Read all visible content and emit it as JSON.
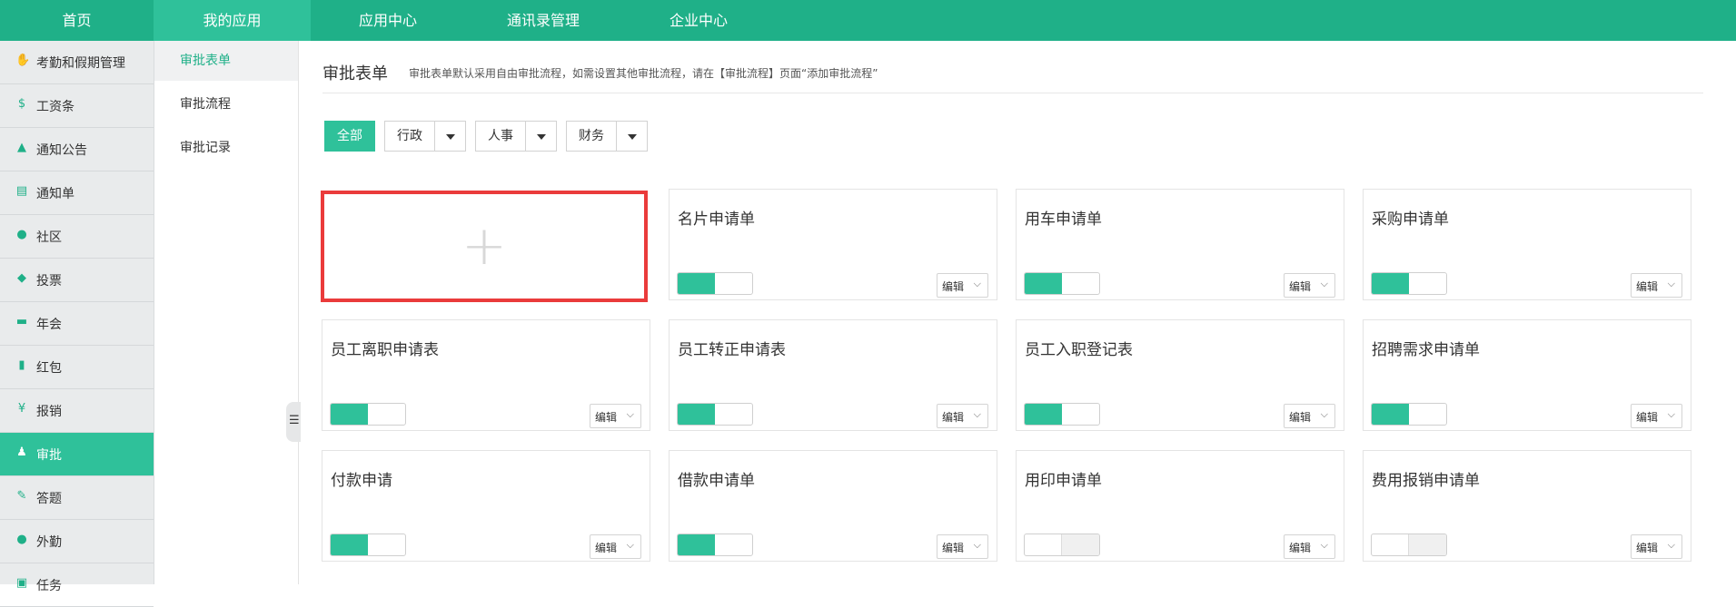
{
  "topnav": {
    "tabs": [
      {
        "label": "首页"
      },
      {
        "label": "我的应用"
      },
      {
        "label": "应用中心"
      },
      {
        "label": "通讯录管理"
      },
      {
        "label": "企业中心"
      }
    ],
    "active_index": 1
  },
  "sidebar": {
    "items": [
      {
        "label": "考勤和假期管理",
        "icon": "hand-icon"
      },
      {
        "label": "工资条",
        "icon": "salary-icon"
      },
      {
        "label": "通知公告",
        "icon": "bell-icon"
      },
      {
        "label": "通知单",
        "icon": "notice-icon"
      },
      {
        "label": "社区",
        "icon": "chat-icon"
      },
      {
        "label": "投票",
        "icon": "vote-icon"
      },
      {
        "label": "年会",
        "icon": "card-icon"
      },
      {
        "label": "红包",
        "icon": "redpacket-icon"
      },
      {
        "label": "报销",
        "icon": "yen-icon"
      },
      {
        "label": "审批",
        "icon": "stamp-icon"
      },
      {
        "label": "答题",
        "icon": "quiz-icon"
      },
      {
        "label": "外勤",
        "icon": "location-icon"
      },
      {
        "label": "任务",
        "icon": "task-icon"
      }
    ],
    "active_index": 9
  },
  "submenu": {
    "items": [
      {
        "label": "审批表单"
      },
      {
        "label": "审批流程"
      },
      {
        "label": "审批记录"
      }
    ],
    "active_index": 0
  },
  "main": {
    "title": "审批表单",
    "description": "审批表单默认采用自由审批流程，如需设置其他审批流程，请在【审批流程】页面“添加审批流程”",
    "filters": [
      {
        "label": "全部",
        "active": true,
        "dropdown": false
      },
      {
        "label": "行政",
        "active": false,
        "dropdown": true
      },
      {
        "label": "人事",
        "active": false,
        "dropdown": true
      },
      {
        "label": "财务",
        "active": false,
        "dropdown": true
      }
    ],
    "add_icon": "+",
    "edit_label": "编辑",
    "edit_chevron": "⌵",
    "forms": [
      {
        "name": "名片申请单",
        "enabled": true
      },
      {
        "name": "用车申请单",
        "enabled": true
      },
      {
        "name": "采购申请单",
        "enabled": true
      },
      {
        "name": "员工离职申请表",
        "enabled": true
      },
      {
        "name": "员工转正申请表",
        "enabled": true
      },
      {
        "name": "员工入职登记表",
        "enabled": true
      },
      {
        "name": "招聘需求申请单",
        "enabled": true
      },
      {
        "name": "付款申请",
        "enabled": true
      },
      {
        "name": "借款申请单",
        "enabled": true
      },
      {
        "name": "用印申请单",
        "enabled": false
      },
      {
        "name": "费用报销申请单",
        "enabled": false
      }
    ]
  },
  "colors": {
    "brand": "#1fb088",
    "active_green": "#2fc19a",
    "highlight_border": "#ea3b3b"
  }
}
